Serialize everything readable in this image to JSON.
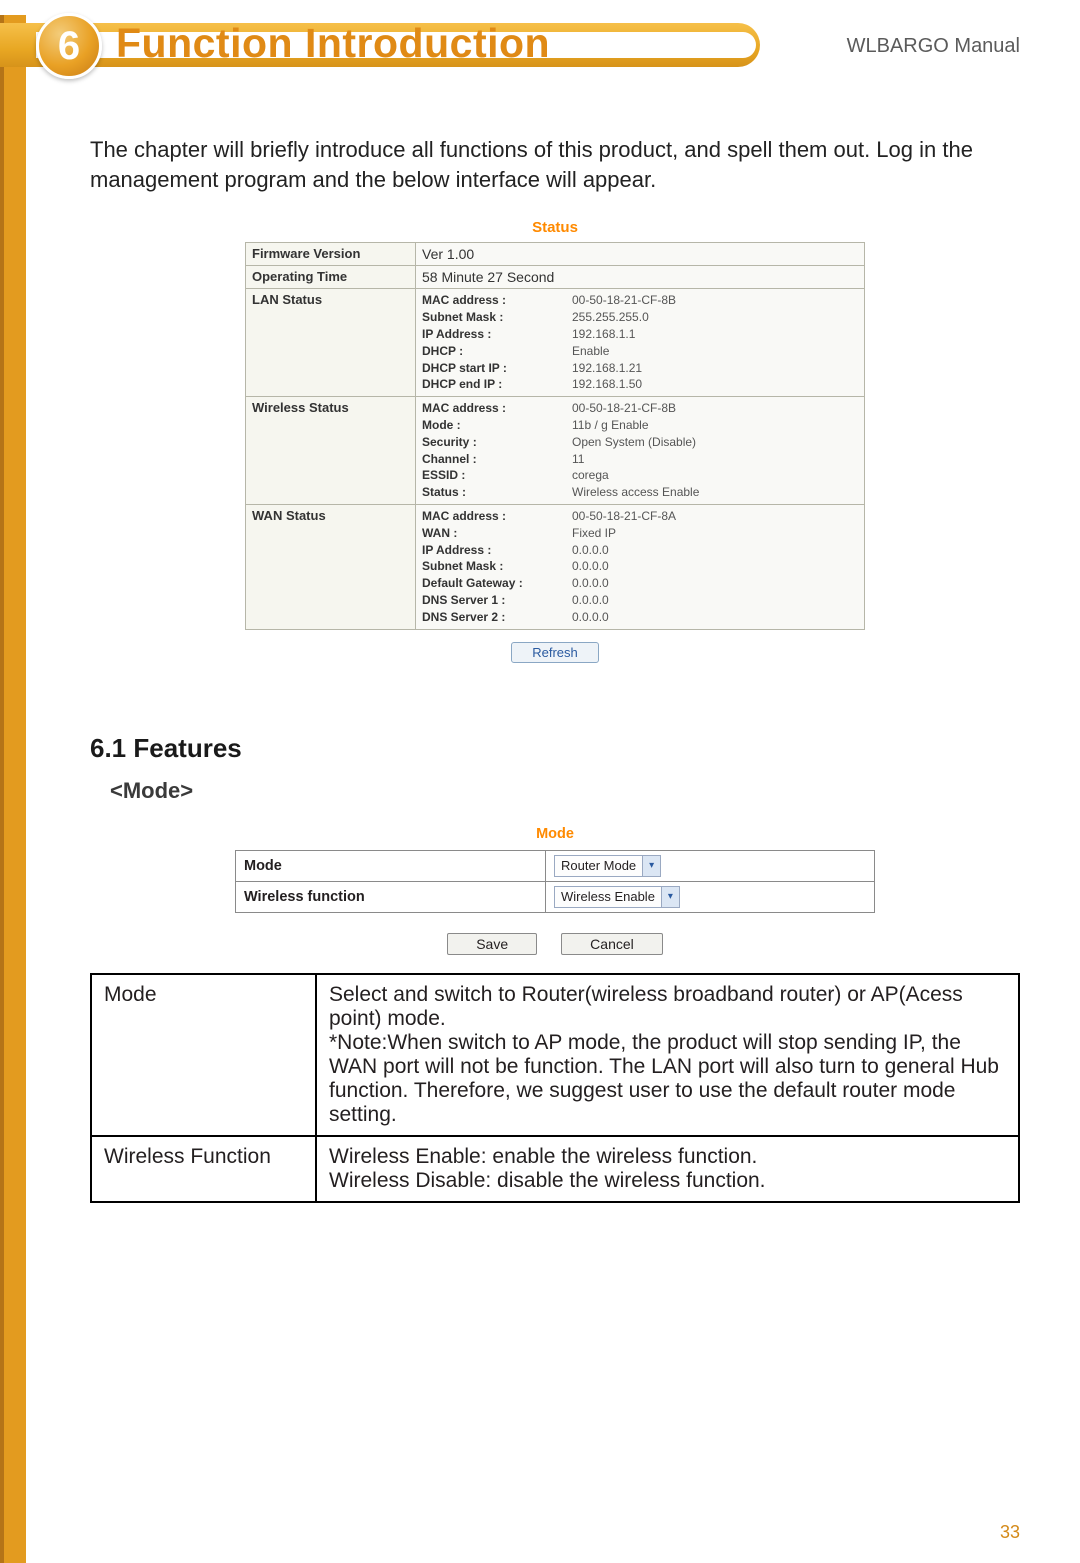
{
  "header": {
    "chapter_number": "6",
    "title": "Function Introduction",
    "manual_label": "WLBARGO Manual"
  },
  "intro_text": "The chapter will briefly introduce all functions of this product, and spell them out.  Log in the management program and the below interface will appear.",
  "status_panel": {
    "title": "Status",
    "firmware_label": "Firmware Version",
    "firmware_value": "Ver 1.00",
    "optime_label": "Operating Time",
    "optime_value": "58 Minute 27 Second",
    "lan_label": "LAN Status",
    "lan": {
      "mac_k": "MAC address :",
      "mac_v": "00-50-18-21-CF-8B",
      "mask_k": "Subnet Mask :",
      "mask_v": "255.255.255.0",
      "ip_k": "IP Address :",
      "ip_v": "192.168.1.1",
      "dhcp_k": "DHCP :",
      "dhcp_v": "Enable",
      "dstart_k": "DHCP start IP :",
      "dstart_v": "192.168.1.21",
      "dend_k": "DHCP end IP :",
      "dend_v": "192.168.1.50"
    },
    "wl_label": "Wireless Status",
    "wl": {
      "mac_k": "MAC address :",
      "mac_v": "00-50-18-21-CF-8B",
      "mode_k": "Mode :",
      "mode_v": "11b / g Enable",
      "sec_k": "Security :",
      "sec_v": "Open System (Disable)",
      "ch_k": "Channel :",
      "ch_v": "11",
      "essid_k": "ESSID :",
      "essid_v": "corega",
      "stat_k": "Status :",
      "stat_v": "Wireless access Enable"
    },
    "wan_label": "WAN Status",
    "wan": {
      "mac_k": "MAC address :",
      "mac_v": "00-50-18-21-CF-8A",
      "wan_k": "WAN :",
      "wan_v": "Fixed IP",
      "ip_k": "IP Address :",
      "ip_v": "0.0.0.0",
      "mask_k": "Subnet Mask :",
      "mask_v": "0.0.0.0",
      "gw_k": "Default Gateway :",
      "gw_v": "0.0.0.0",
      "dns1_k": "DNS Server 1 :",
      "dns1_v": "0.0.0.0",
      "dns2_k": "DNS Server 2 :",
      "dns2_v": "0.0.0.0"
    },
    "refresh_label": "Refresh"
  },
  "section": {
    "heading": "6.1 Features",
    "subheading": "<Mode>"
  },
  "mode_panel": {
    "title": "Mode",
    "row1_label": "Mode",
    "row1_value": "Router Mode",
    "row2_label": "Wireless function",
    "row2_value": "Wireless Enable",
    "save_label": "Save",
    "cancel_label": "Cancel"
  },
  "explain_table": {
    "r1_label": "Mode",
    "r1_text": "Select and switch to Router(wireless broadband router) or AP(Acess point) mode.\n*Note:When switch to AP mode, the product will stop sending IP, the WAN port will not be function. The LAN port will also turn to general Hub function. Therefore, we suggest user to use the default router mode setting.",
    "r2_label": "Wireless Function",
    "r2_text": "Wireless Enable: enable the wireless function.\nWireless Disable: disable the wireless function."
  },
  "page_number": "33"
}
